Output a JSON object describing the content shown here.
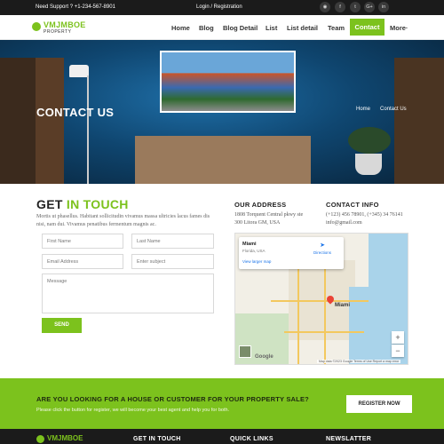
{
  "topbar": {
    "support": "Need Support ? +1-234-567-8901",
    "login": "Login / Registration",
    "social_icons": [
      "rss-icon",
      "facebook-icon",
      "twitter-icon",
      "google-plus-icon",
      "linkedin-icon"
    ],
    "social_glyphs": [
      "◉",
      "f",
      "t",
      "G+",
      "in"
    ]
  },
  "logo": {
    "name": "VMJMBOE",
    "sub": "PROPERTY"
  },
  "nav": {
    "items": [
      "Home",
      "Blog",
      "Blog Detail",
      "List",
      "List detail",
      "Team"
    ],
    "active": "Contact",
    "more": "More·"
  },
  "hero": {
    "title": "CONTACT US",
    "breadcrumb": [
      "Home",
      "Contact Us"
    ]
  },
  "form": {
    "heading_a": "GET",
    "heading_b": "IN TOUCH",
    "intro": "Mortis ut phasellus. Habitant sollicitudin vivamus massa ultricies lacus fames dis nisi, nam dui. Vivamus penatibus fermentum magnis ac.",
    "first_name": "First Name",
    "last_name": "Last Name",
    "email": "Email Address",
    "subject": "Enter subject",
    "message": "Message",
    "send": "SEND"
  },
  "address": {
    "heading": "OUR ADDRESS",
    "lines": [
      "1808 Torquent Central pkwy ste",
      "300 Litora GM, USA"
    ]
  },
  "contact_info": {
    "heading": "CONTACT INFO",
    "lines": [
      "(+123) 456 78901, (+345) 34 76141",
      "info@gmail.com"
    ]
  },
  "map": {
    "city": "Miami",
    "state": "Florida, USA",
    "directions": "Directions",
    "larger": "View larger map",
    "pin_label": "Miami",
    "zoom_in": "+",
    "zoom_out": "−",
    "google": "Google",
    "attribution": "Map data ©2023 Google   Terms of Use   Report a map error"
  },
  "cta": {
    "question": "ARE YOU LOOKING FOR A HOUSE OR CUSTOMER FOR YOUR PROPERTY SALE?",
    "subtext": "Please click the button for register, we will become your best agent and help you for both.",
    "button": "REGISTER NOW"
  },
  "footer": {
    "logo": "VMJMBOE",
    "headings": [
      "GET IN TOUCH",
      "QUICK LINKS",
      "NEWSLATTER"
    ]
  },
  "colors": {
    "accent": "#7cc21d",
    "dark": "#1b1b1b"
  }
}
